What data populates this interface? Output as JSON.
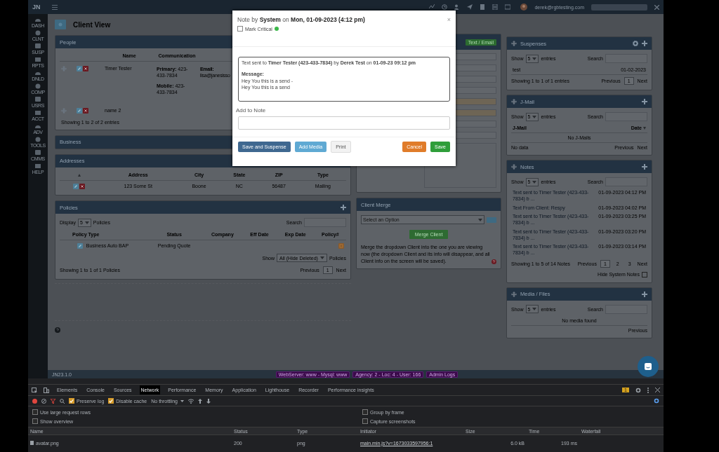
{
  "topbar": {
    "logo": "JN",
    "user": "derek@rgbtesting.com"
  },
  "sidebar": {
    "items": [
      {
        "label": "DASH"
      },
      {
        "label": "CLNT"
      },
      {
        "label": "SUSP"
      },
      {
        "label": "RPTS"
      },
      {
        "label": "DNLD"
      },
      {
        "label": "COMP"
      },
      {
        "label": "USRS"
      },
      {
        "label": "ACCT"
      },
      {
        "label": "ADV"
      },
      {
        "label": "TOOLS"
      },
      {
        "label": "CMMS"
      },
      {
        "label": "HELP"
      }
    ]
  },
  "page_title": "Client View",
  "people": {
    "title": "People",
    "columns": [
      "Name",
      "Communication"
    ],
    "rows": [
      {
        "name": "Timer Tester",
        "lines": [
          "**Primary:** 423-433-7834",
          "**Mobile:** 423-433-7834"
        ],
        "email": "**Email:** lisa@janesisso"
      },
      {
        "name": "name 2",
        "lines": []
      }
    ],
    "info": "Showing 1 to 2 of 2 entries"
  },
  "business": {
    "title": "Business"
  },
  "addresses": {
    "title": "Addresses",
    "columns": [
      "Address",
      "City",
      "State",
      "ZIP",
      "Type"
    ],
    "rows": [
      [
        "123 Some St",
        "Boone",
        "NC",
        "56487",
        "Mailing"
      ]
    ]
  },
  "policies": {
    "title": "Policies",
    "display": "Display",
    "length": "5",
    "display_suffix": "Policies",
    "search": "Search",
    "columns": [
      "Policy Type",
      "Status",
      "Company",
      "Eff Date",
      "Exp Date",
      "Policy#"
    ],
    "rows": [
      [
        "Business Auto BAP",
        "Pending Quote",
        "",
        "",
        "",
        ""
      ]
    ],
    "show": "Show",
    "filter": "All (Hide Deleted)",
    "filter_suffix": "Policies",
    "info": "Showing 1 to 1 of 1 Policies",
    "pager": {
      "previous": "Previous",
      "pages": [
        {
          "label": "1",
          "selected": true
        }
      ],
      "next": "Next"
    }
  },
  "client_details": {
    "button": "Text / Email"
  },
  "client_merge": {
    "title": "Client Merge",
    "select": "Select an Option",
    "button": "Merge Client",
    "text": "Merge the dropdown Client into the one you are viewing now (the dropdown Client and its info will disappear, and all Client info on the screen will be saved)."
  },
  "suspenses": {
    "title": "Suspenses",
    "show": "Show",
    "length": "5",
    "entries": "entries",
    "search": "Search",
    "rows": [
      [
        "test",
        "01-02-2023"
      ]
    ],
    "info": "Showing 1 to 1 of 1 entries",
    "pager": {
      "previous": "Previous",
      "pages": [
        {
          "label": "1",
          "selected": true
        }
      ],
      "next": "Next"
    }
  },
  "jmail": {
    "title": "J-Mail",
    "show": "Show",
    "length": "5",
    "entries": "entries",
    "search": "Search",
    "columns": [
      "J-Mail",
      "Date"
    ],
    "empty": "No J-Mails",
    "info": "No data",
    "pager": {
      "previous": "Previous",
      "next": "Next"
    }
  },
  "notes": {
    "title": "Notes",
    "show": "Show",
    "length": "5",
    "entries": "entries",
    "search": "Search",
    "rows": [
      [
        "Text sent to Timer Tester (423-433-7834) b ...",
        "01-09-2023 04:12 PM"
      ],
      [
        "Text From Client: Respy",
        "01-09-2023 04:02 PM"
      ],
      [
        "Text sent to Timer Tester (423-433-7834) b ...",
        "01-09-2023 03:25 PM"
      ],
      [
        "Text sent to Timer Tester (423-433-7834) b ...",
        "01-09-2023 03:20 PM"
      ],
      [
        "Text sent to Timer Tester (423-433-7834) b ...",
        "01-09-2023 03:14 PM"
      ]
    ],
    "info": "Showing 1 to 5 of 14 Notes",
    "pager": {
      "previous": "Previous",
      "pages": [
        {
          "label": "1",
          "selected": true
        },
        {
          "label": "2",
          "selected": false
        },
        {
          "label": "3",
          "selected": false
        }
      ],
      "next": "Next"
    },
    "hide_system": {
      "label": "Hide System Notes",
      "checked": false
    }
  },
  "media": {
    "title": "Media / Files",
    "show": "Show",
    "length": "5",
    "entries": "entries",
    "search": "Search",
    "empty": "No media found",
    "previous": "Previous"
  },
  "footer": {
    "version": "JN23.1.0",
    "badges": [
      "WebServer: www - Mysql: www",
      "Agency: 2 - Loc: 4 - User: 166",
      "Admin Logs"
    ]
  },
  "modal": {
    "title": "Note by **System** on **Mon, 01-09-2023 (4:12 pm)**",
    "close": "×",
    "mark_critical": {
      "label": "Mark Critical",
      "checked": false
    },
    "note_header": "Text sent to **Timer Tester (423-433-7834)** by **Derek Test** on **01-09-23 09:12 pm**",
    "message_label": "Message:",
    "message_lines": [
      "Hey You this is a send -",
      "Hey You this is a send"
    ],
    "add_label": "Add to Note",
    "buttons": [
      {
        "label": "Save and Suspense",
        "kind": "suspense"
      },
      {
        "label": "Add Media",
        "kind": "info"
      },
      {
        "label": "Print",
        "kind": "plain"
      },
      {
        "label": "Cancel",
        "kind": "warning"
      },
      {
        "label": "Save",
        "kind": "success"
      }
    ]
  },
  "devtools": {
    "tabs": [
      {
        "label": "Elements",
        "selected": false
      },
      {
        "label": "Console",
        "selected": false
      },
      {
        "label": "Sources",
        "selected": false
      },
      {
        "label": "Network",
        "selected": true
      },
      {
        "label": "Performance",
        "selected": false
      },
      {
        "label": "Memory",
        "selected": false
      },
      {
        "label": "Application",
        "selected": false
      },
      {
        "label": "Lighthouse",
        "selected": false
      },
      {
        "label": "Recorder",
        "selected": false
      },
      {
        "label": "Performance insights",
        "selected": false
      }
    ],
    "issues": "1",
    "preserve_log": {
      "label": "Preserve log",
      "checked": true
    },
    "disable_cache": {
      "label": "Disable cache",
      "checked": true
    },
    "throttling": "No throttling",
    "options": [
      {
        "label": "Use large request rows",
        "checked": false
      },
      {
        "label": "Group by frame",
        "checked": false
      },
      {
        "label": "Show overview",
        "checked": false
      },
      {
        "label": "Capture screenshots",
        "checked": false
      }
    ],
    "columns": [
      "Name",
      "Status",
      "Type",
      "Initiator",
      "Size",
      "Time",
      "Waterfall"
    ],
    "rows": [
      [
        "avatar.png",
        "200",
        "png",
        "main.min.js?v=1673033597956:1",
        "6.0 kB",
        "193 ms"
      ]
    ]
  }
}
